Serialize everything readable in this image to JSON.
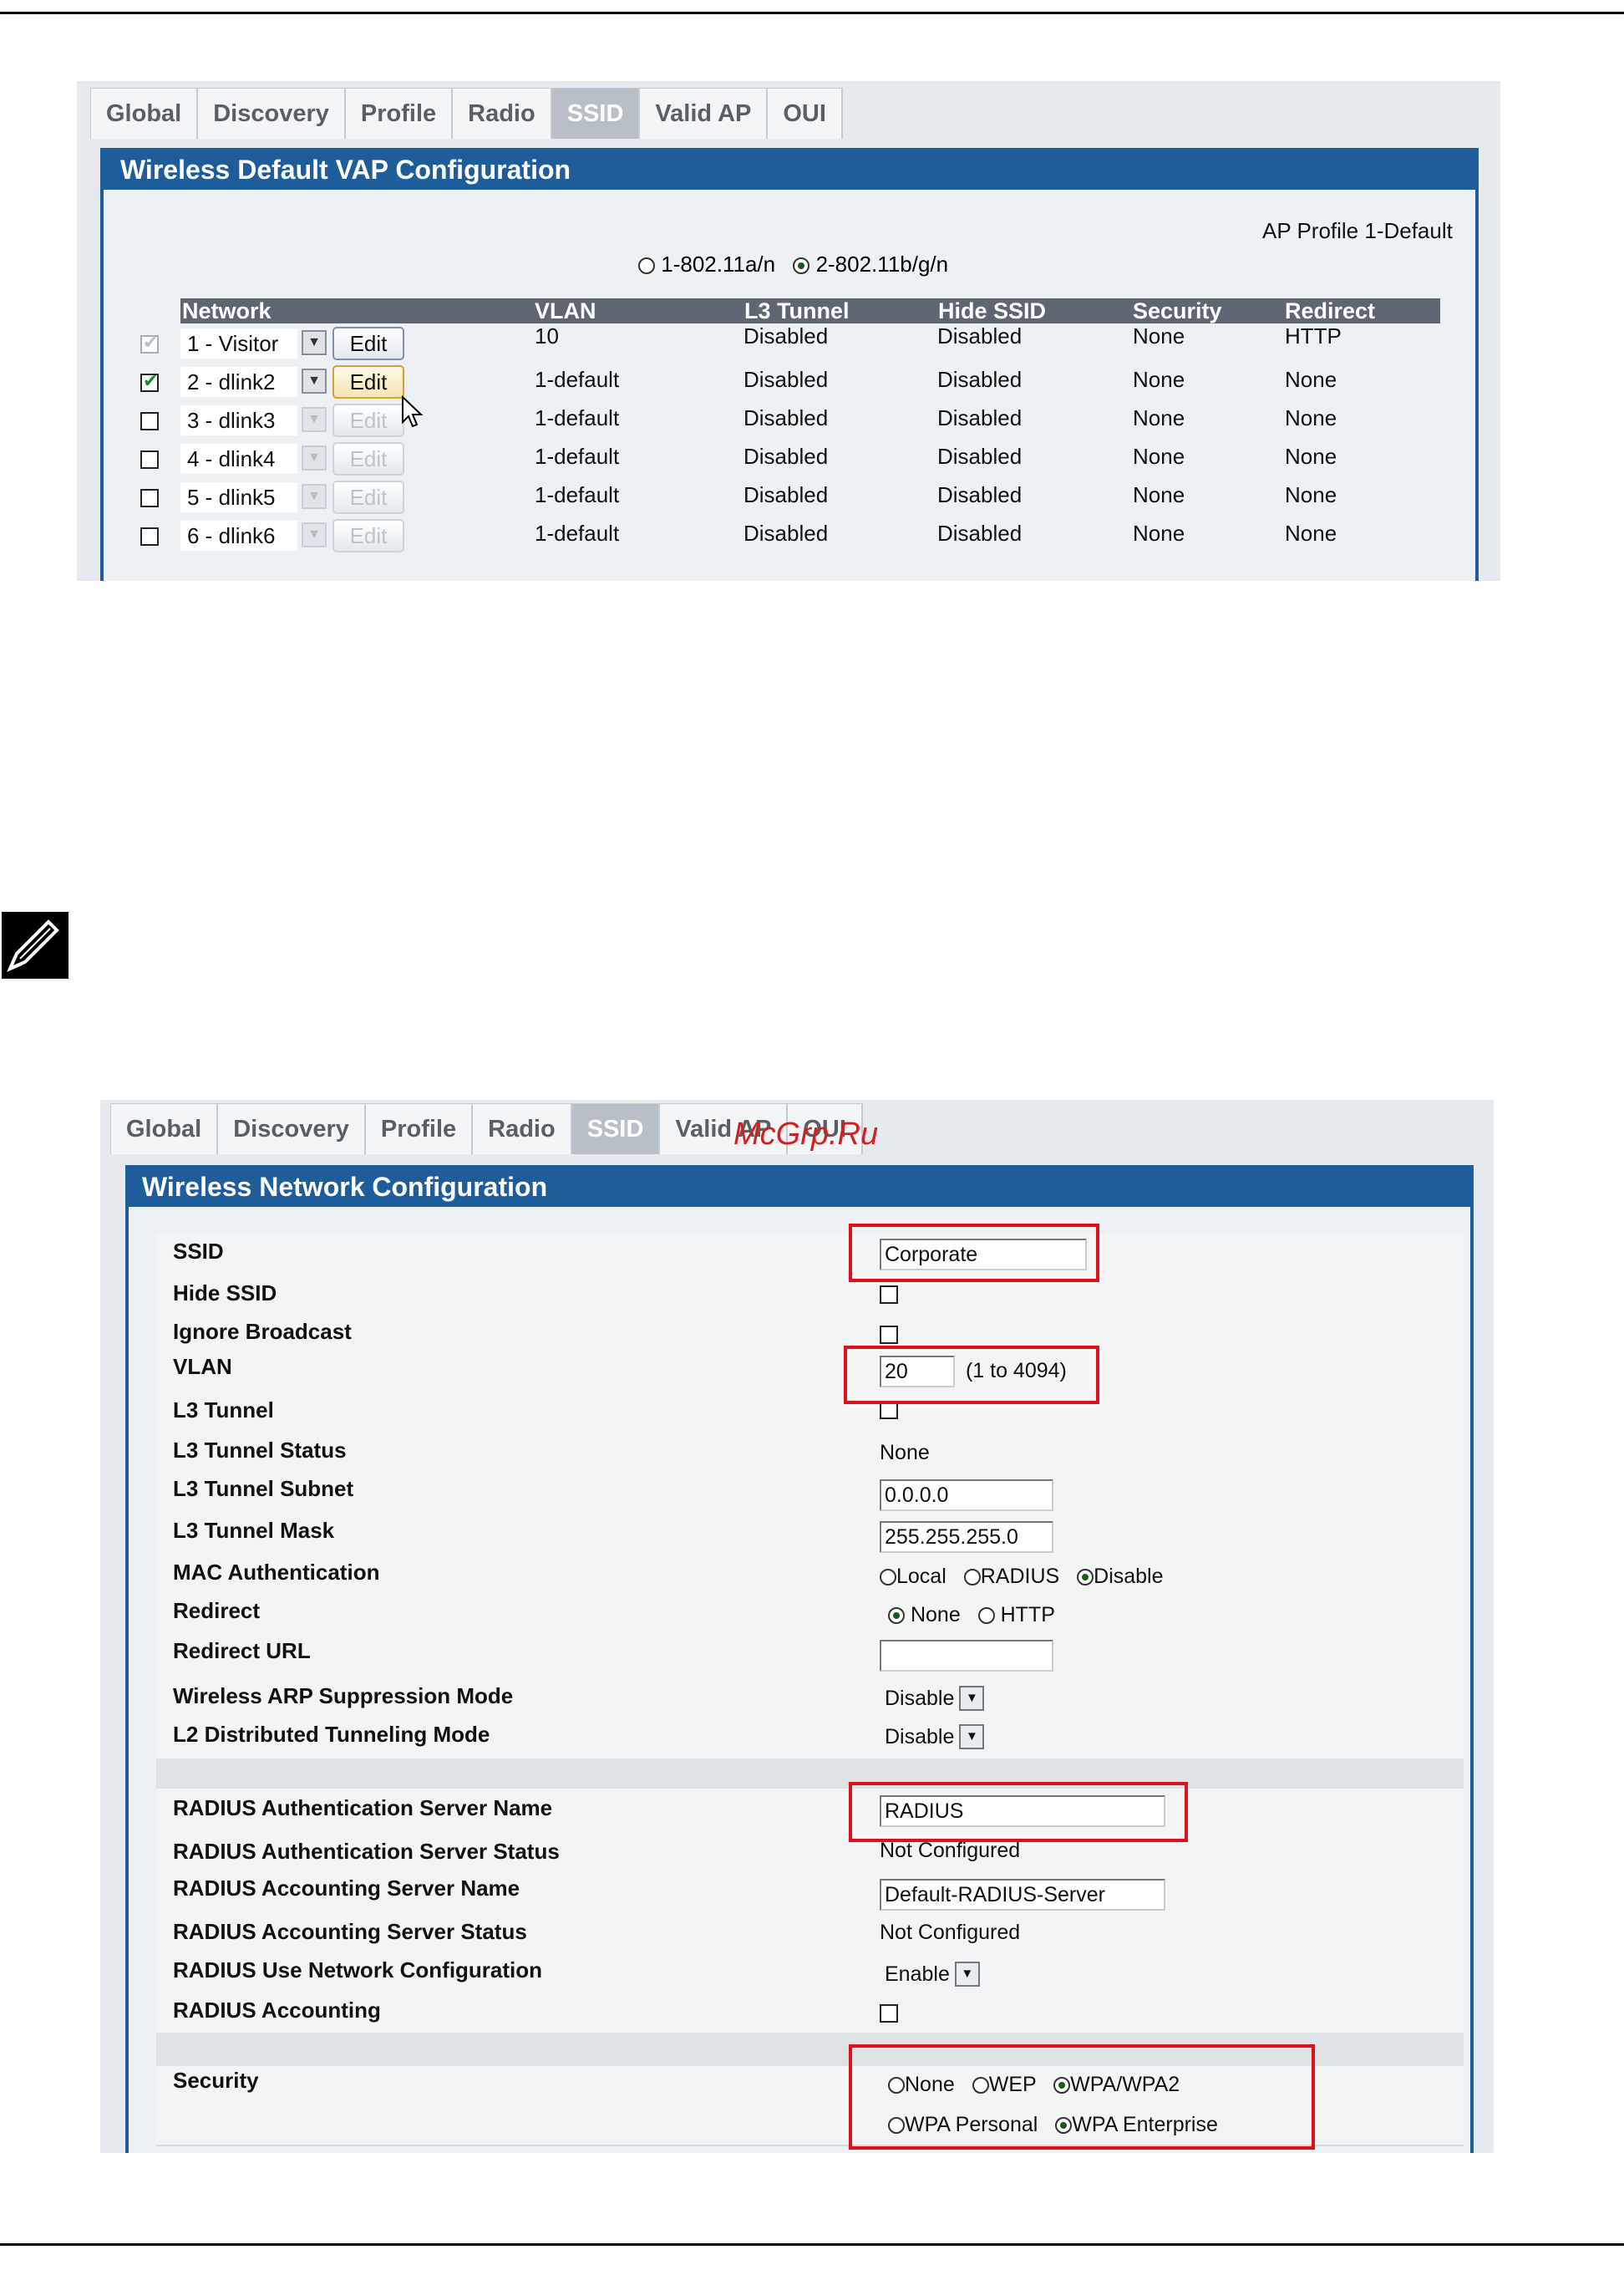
{
  "tabs": [
    "Global",
    "Discovery",
    "Profile",
    "Radio",
    "SSID",
    "Valid AP",
    "OUI"
  ],
  "shot1": {
    "title": "Wireless Default VAP Configuration",
    "profile": "AP Profile 1-Default",
    "radio_a": "1-802.11a/n",
    "radio_b": "2-802.11b/g/n",
    "columns": [
      "Network",
      "VLAN",
      "L3 Tunnel",
      "Hide SSID",
      "Security",
      "Redirect"
    ],
    "edit_label": "Edit",
    "rows": [
      {
        "network": "1 - Visitor",
        "vlan": "10",
        "l3": "Disabled",
        "hide": "Disabled",
        "security": "None",
        "redirect": "HTTP",
        "checked": true,
        "disabled_check": true,
        "enabled": true
      },
      {
        "network": "2 - dlink2",
        "vlan": "1-default",
        "l3": "Disabled",
        "hide": "Disabled",
        "security": "None",
        "redirect": "None",
        "checked": true,
        "disabled_check": false,
        "enabled": true
      },
      {
        "network": "3 - dlink3",
        "vlan": "1-default",
        "l3": "Disabled",
        "hide": "Disabled",
        "security": "None",
        "redirect": "None",
        "checked": false,
        "disabled_check": false,
        "enabled": false
      },
      {
        "network": "4 - dlink4",
        "vlan": "1-default",
        "l3": "Disabled",
        "hide": "Disabled",
        "security": "None",
        "redirect": "None",
        "checked": false,
        "disabled_check": false,
        "enabled": false
      },
      {
        "network": "5 - dlink5",
        "vlan": "1-default",
        "l3": "Disabled",
        "hide": "Disabled",
        "security": "None",
        "redirect": "None",
        "checked": false,
        "disabled_check": false,
        "enabled": false
      },
      {
        "network": "6 - dlink6",
        "vlan": "1-default",
        "l3": "Disabled",
        "hide": "Disabled",
        "security": "None",
        "redirect": "None",
        "checked": false,
        "disabled_check": false,
        "enabled": false
      }
    ]
  },
  "shot2": {
    "title": "Wireless Network Configuration",
    "watermark": "McGrp.Ru",
    "ssid_label": "SSID",
    "ssid_value": "Corporate",
    "hide_ssid_label": "Hide SSID",
    "ignore_broadcast_label": "Ignore Broadcast",
    "vlan_label": "VLAN",
    "vlan_value": "20",
    "vlan_range": "(1 to 4094)",
    "l3_tunnel_label": "L3 Tunnel",
    "l3_status_label": "L3 Tunnel Status",
    "l3_status_value": "None",
    "l3_subnet_label": "L3 Tunnel Subnet",
    "l3_subnet_value": "0.0.0.0",
    "l3_mask_label": "L3 Tunnel Mask",
    "l3_mask_value": "255.255.255.0",
    "mac_auth_label": "MAC Authentication",
    "mac_local": "Local",
    "mac_radius": "RADIUS",
    "mac_disable": "Disable",
    "redirect_label": "Redirect",
    "redirect_none": "None",
    "redirect_http": "HTTP",
    "redirect_url_label": "Redirect URL",
    "redirect_url_value": "",
    "arp_label": "Wireless ARP Suppression Mode",
    "arp_value": "Disable",
    "l2_label": "L2 Distributed Tunneling Mode",
    "l2_value": "Disable",
    "radius_auth_name_label": "RADIUS Authentication Server Name",
    "radius_auth_name_value": "RADIUS",
    "radius_auth_status_label": "RADIUS Authentication Server Status",
    "radius_auth_status_value": "Not Configured",
    "radius_acct_name_label": "RADIUS Accounting Server Name",
    "radius_acct_name_value": "Default-RADIUS-Server",
    "radius_acct_status_label": "RADIUS Accounting Server Status",
    "radius_acct_status_value": "Not Configured",
    "radius_use_net_label": "RADIUS Use Network Configuration",
    "radius_use_net_value": "Enable",
    "radius_acct_label": "RADIUS Accounting",
    "security_label": "Security",
    "sec_none": "None",
    "sec_wep": "WEP",
    "sec_wpa": "WPA/WPA2",
    "wpa_personal": "WPA Personal",
    "wpa_enterprise": "WPA Enterprise"
  }
}
